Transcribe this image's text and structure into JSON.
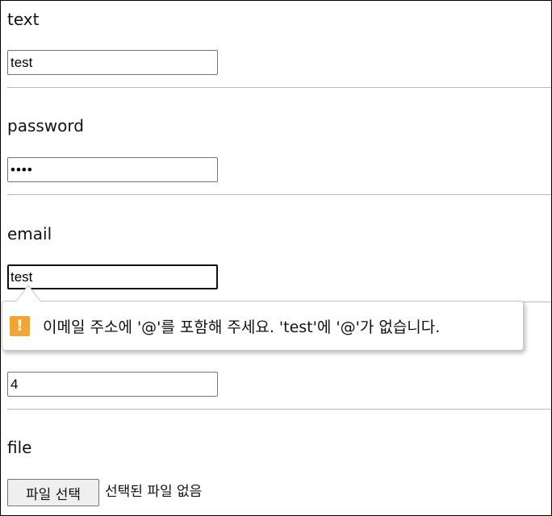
{
  "form": {
    "text": {
      "label": "text",
      "value": "test"
    },
    "password": {
      "label": "password",
      "value": "••••"
    },
    "email": {
      "label": "email",
      "value": "test"
    },
    "number": {
      "value": "4"
    },
    "file": {
      "label": "file",
      "button_label": "파일 선택",
      "status": "선택된 파일 없음"
    }
  },
  "validation_tooltip": {
    "icon": "warning-icon",
    "icon_glyph": "!",
    "message": "이메일 주소에 '@'를 포함해 주세요. 'test'에 '@'가 없습니다.",
    "icon_color": "#f0a536"
  }
}
